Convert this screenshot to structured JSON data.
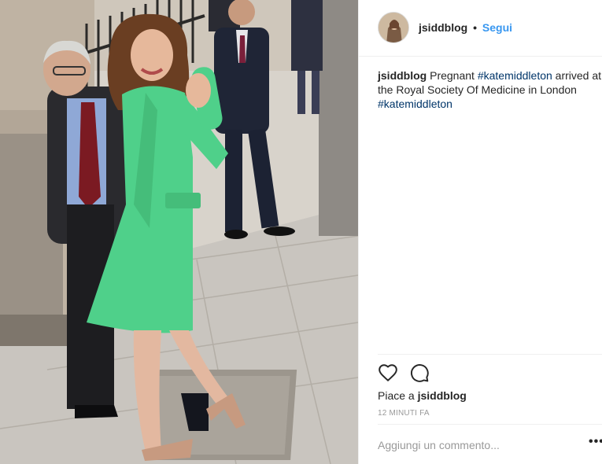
{
  "post": {
    "username": "jsiddblog",
    "header_separator": "•",
    "follow_label": "Segui",
    "caption": {
      "username": "jsiddblog",
      "text_1": " Pregnant ",
      "hashtag_1": "#katemiddleton",
      "text_2": " arrived at the Royal Society Of Medicine in London ",
      "hashtag_2": "#katemiddleton"
    },
    "likes": {
      "prefix": "Piace a ",
      "username": "jsiddblog"
    },
    "timestamp": "12 MINUTI FA",
    "comment_placeholder": "Aggiungi un commento...",
    "more_label": "•••"
  },
  "icons": {
    "like": "heart-icon",
    "comment": "comment-bubble-icon",
    "more": "more-options-icon"
  },
  "colors": {
    "link_blue": "#3897f0",
    "hashtag_blue": "#003569",
    "muted_gray": "#999999",
    "coat_green": "#4fd08a"
  }
}
